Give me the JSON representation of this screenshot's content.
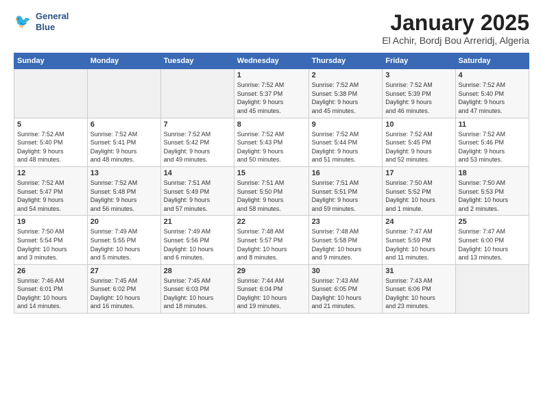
{
  "logo": {
    "line1": "General",
    "line2": "Blue"
  },
  "title": "January 2025",
  "subtitle": "El Achir, Bordj Bou Arreridj, Algeria",
  "headers": [
    "Sunday",
    "Monday",
    "Tuesday",
    "Wednesday",
    "Thursday",
    "Friday",
    "Saturday"
  ],
  "weeks": [
    [
      {
        "num": "",
        "info": ""
      },
      {
        "num": "",
        "info": ""
      },
      {
        "num": "",
        "info": ""
      },
      {
        "num": "1",
        "info": "Sunrise: 7:52 AM\nSunset: 5:37 PM\nDaylight: 9 hours\nand 45 minutes."
      },
      {
        "num": "2",
        "info": "Sunrise: 7:52 AM\nSunset: 5:38 PM\nDaylight: 9 hours\nand 45 minutes."
      },
      {
        "num": "3",
        "info": "Sunrise: 7:52 AM\nSunset: 5:39 PM\nDaylight: 9 hours\nand 46 minutes."
      },
      {
        "num": "4",
        "info": "Sunrise: 7:52 AM\nSunset: 5:40 PM\nDaylight: 9 hours\nand 47 minutes."
      }
    ],
    [
      {
        "num": "5",
        "info": "Sunrise: 7:52 AM\nSunset: 5:40 PM\nDaylight: 9 hours\nand 48 minutes."
      },
      {
        "num": "6",
        "info": "Sunrise: 7:52 AM\nSunset: 5:41 PM\nDaylight: 9 hours\nand 48 minutes."
      },
      {
        "num": "7",
        "info": "Sunrise: 7:52 AM\nSunset: 5:42 PM\nDaylight: 9 hours\nand 49 minutes."
      },
      {
        "num": "8",
        "info": "Sunrise: 7:52 AM\nSunset: 5:43 PM\nDaylight: 9 hours\nand 50 minutes."
      },
      {
        "num": "9",
        "info": "Sunrise: 7:52 AM\nSunset: 5:44 PM\nDaylight: 9 hours\nand 51 minutes."
      },
      {
        "num": "10",
        "info": "Sunrise: 7:52 AM\nSunset: 5:45 PM\nDaylight: 9 hours\nand 52 minutes."
      },
      {
        "num": "11",
        "info": "Sunrise: 7:52 AM\nSunset: 5:46 PM\nDaylight: 9 hours\nand 53 minutes."
      }
    ],
    [
      {
        "num": "12",
        "info": "Sunrise: 7:52 AM\nSunset: 5:47 PM\nDaylight: 9 hours\nand 54 minutes."
      },
      {
        "num": "13",
        "info": "Sunrise: 7:52 AM\nSunset: 5:48 PM\nDaylight: 9 hours\nand 56 minutes."
      },
      {
        "num": "14",
        "info": "Sunrise: 7:51 AM\nSunset: 5:49 PM\nDaylight: 9 hours\nand 57 minutes."
      },
      {
        "num": "15",
        "info": "Sunrise: 7:51 AM\nSunset: 5:50 PM\nDaylight: 9 hours\nand 58 minutes."
      },
      {
        "num": "16",
        "info": "Sunrise: 7:51 AM\nSunset: 5:51 PM\nDaylight: 9 hours\nand 59 minutes."
      },
      {
        "num": "17",
        "info": "Sunrise: 7:50 AM\nSunset: 5:52 PM\nDaylight: 10 hours\nand 1 minute."
      },
      {
        "num": "18",
        "info": "Sunrise: 7:50 AM\nSunset: 5:53 PM\nDaylight: 10 hours\nand 2 minutes."
      }
    ],
    [
      {
        "num": "19",
        "info": "Sunrise: 7:50 AM\nSunset: 5:54 PM\nDaylight: 10 hours\nand 3 minutes."
      },
      {
        "num": "20",
        "info": "Sunrise: 7:49 AM\nSunset: 5:55 PM\nDaylight: 10 hours\nand 5 minutes."
      },
      {
        "num": "21",
        "info": "Sunrise: 7:49 AM\nSunset: 5:56 PM\nDaylight: 10 hours\nand 6 minutes."
      },
      {
        "num": "22",
        "info": "Sunrise: 7:48 AM\nSunset: 5:57 PM\nDaylight: 10 hours\nand 8 minutes."
      },
      {
        "num": "23",
        "info": "Sunrise: 7:48 AM\nSunset: 5:58 PM\nDaylight: 10 hours\nand 9 minutes."
      },
      {
        "num": "24",
        "info": "Sunrise: 7:47 AM\nSunset: 5:59 PM\nDaylight: 10 hours\nand 11 minutes."
      },
      {
        "num": "25",
        "info": "Sunrise: 7:47 AM\nSunset: 6:00 PM\nDaylight: 10 hours\nand 13 minutes."
      }
    ],
    [
      {
        "num": "26",
        "info": "Sunrise: 7:46 AM\nSunset: 6:01 PM\nDaylight: 10 hours\nand 14 minutes."
      },
      {
        "num": "27",
        "info": "Sunrise: 7:45 AM\nSunset: 6:02 PM\nDaylight: 10 hours\nand 16 minutes."
      },
      {
        "num": "28",
        "info": "Sunrise: 7:45 AM\nSunset: 6:03 PM\nDaylight: 10 hours\nand 18 minutes."
      },
      {
        "num": "29",
        "info": "Sunrise: 7:44 AM\nSunset: 6:04 PM\nDaylight: 10 hours\nand 19 minutes."
      },
      {
        "num": "30",
        "info": "Sunrise: 7:43 AM\nSunset: 6:05 PM\nDaylight: 10 hours\nand 21 minutes."
      },
      {
        "num": "31",
        "info": "Sunrise: 7:43 AM\nSunset: 6:06 PM\nDaylight: 10 hours\nand 23 minutes."
      },
      {
        "num": "",
        "info": ""
      }
    ]
  ]
}
